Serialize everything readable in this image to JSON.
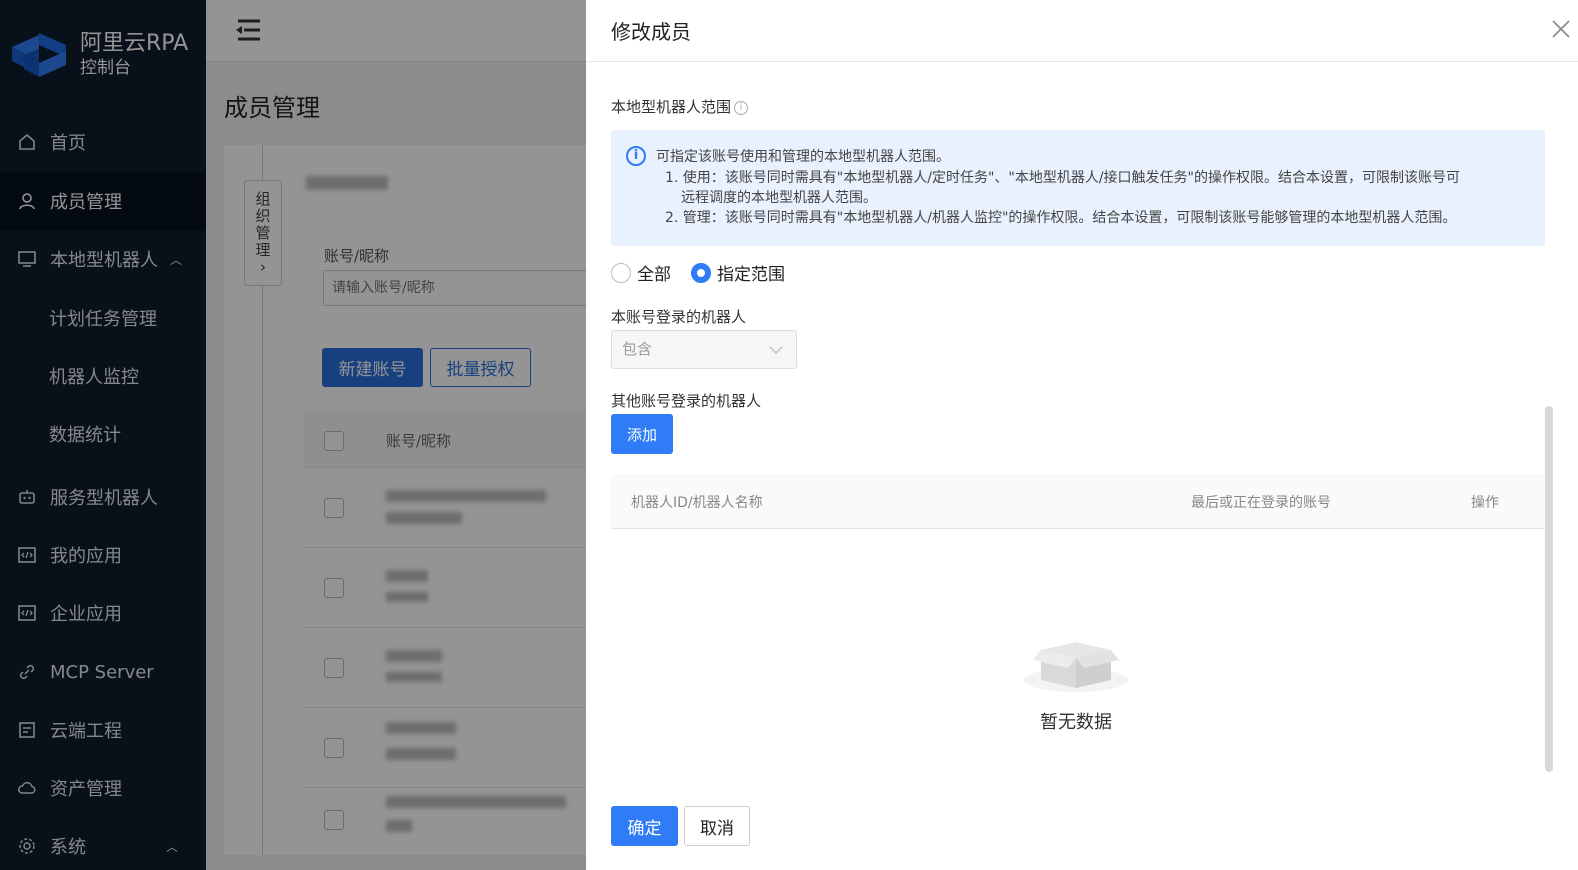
{
  "app": {
    "brand": "阿里云RPA",
    "subtitle": "控制台"
  },
  "sidebar": {
    "items": [
      {
        "label": "首页",
        "icon": "home-icon"
      },
      {
        "label": "成员管理",
        "icon": "user-icon",
        "active": true
      },
      {
        "label": "本地型机器人",
        "icon": "monitor-icon",
        "expanded": true
      },
      {
        "label": "计划任务管理",
        "sub": true
      },
      {
        "label": "机器人监控",
        "sub": true
      },
      {
        "label": "数据统计",
        "sub": true
      },
      {
        "label": "服务型机器人",
        "icon": "robot-icon"
      },
      {
        "label": "我的应用",
        "icon": "code-icon"
      },
      {
        "label": "企业应用",
        "icon": "code-icon"
      },
      {
        "label": "MCP Server",
        "icon": "link-icon"
      },
      {
        "label": "云端工程",
        "icon": "cloud-project-icon"
      },
      {
        "label": "资产管理",
        "icon": "cloud-icon"
      },
      {
        "label": "系统",
        "icon": "gear-icon",
        "expanded": true
      }
    ]
  },
  "main": {
    "page_title": "成员管理",
    "org_tab": "组织管理",
    "account_label": "账号/昵称",
    "search_placeholder": "请输入账号/昵称",
    "new_account_button": "新建账号",
    "batch_auth_button": "批量授权",
    "table_header_account": "账号/昵称"
  },
  "drawer": {
    "title": "修改成员",
    "scope_label": "本地型机器人范围",
    "alert": {
      "title": "可指定该账号使用和管理的本地型机器人范围。",
      "line1": "1. 使用：该账号同时需具有\"本地型机器人/定时任务\"、\"本地型机器人/接口触发任务\"的操作权限。结合本设置，可限制该账号可",
      "line1b": "远程调度的本地型机器人范围。",
      "line2": "2. 管理：该账号同时需具有\"本地型机器人/机器人监控\"的操作权限。结合本设置，可限制该账号能够管理的本地型机器人范围。"
    },
    "radio_all": "全部",
    "radio_specified": "指定范围",
    "own_robots_label": "本账号登录的机器人",
    "own_robots_select": "包含",
    "other_robots_label": "其他账号登录的机器人",
    "add_button": "添加",
    "table": {
      "col_robot": "机器人ID/机器人名称",
      "col_account": "最后或正在登录的账号",
      "col_action": "操作"
    },
    "empty_text": "暂无数据",
    "ok_button": "确定",
    "cancel_button": "取消"
  },
  "colors": {
    "primary": "#2f7cf6",
    "sidebar_bg": "#0f1c2e",
    "alert_bg": "#e9f1fe"
  }
}
